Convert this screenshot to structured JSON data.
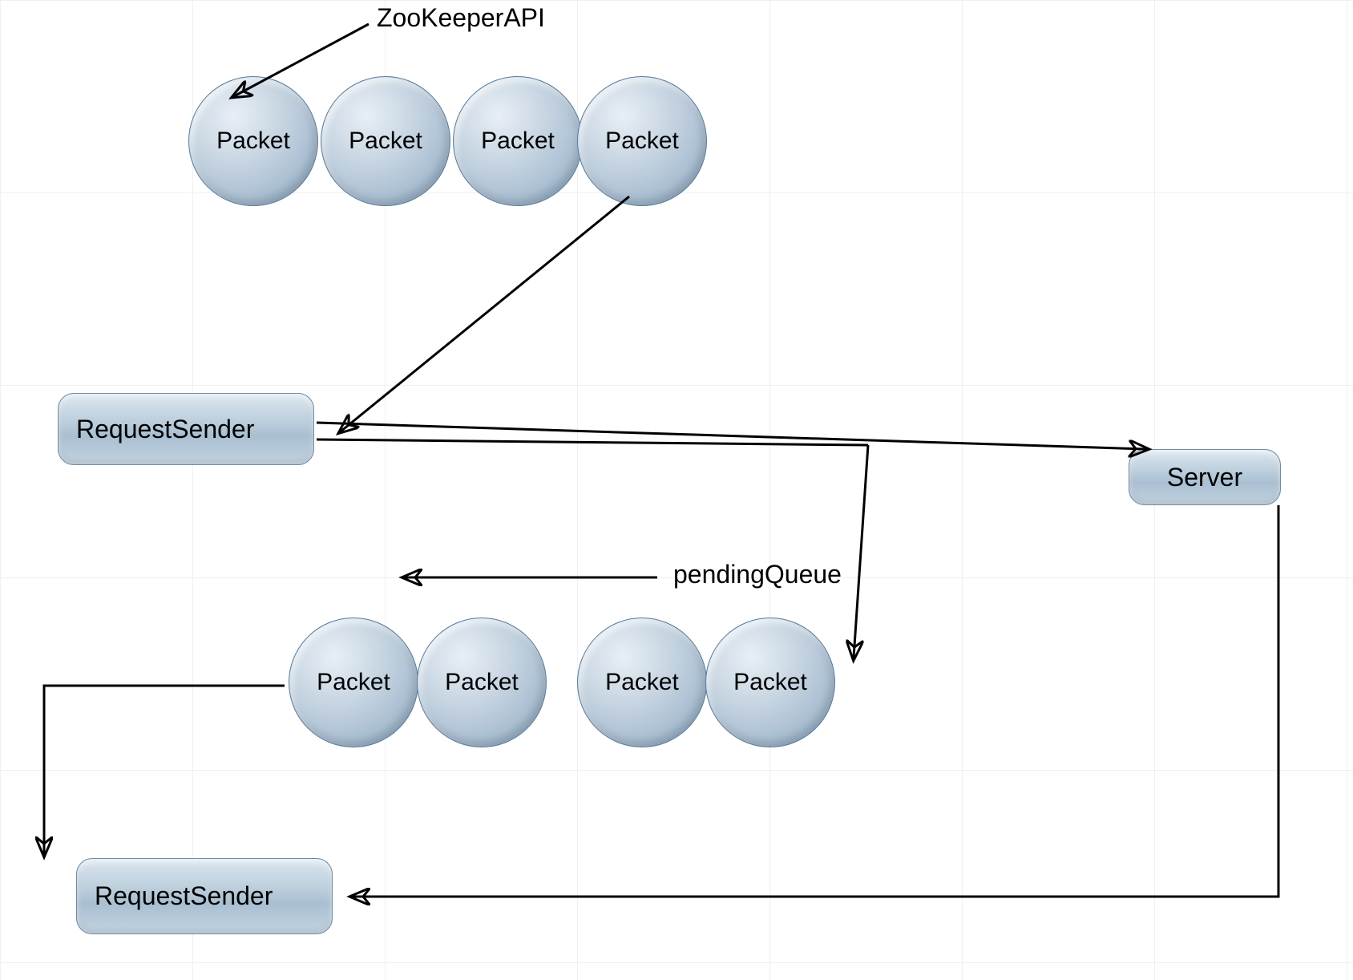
{
  "labels": {
    "zookeeper_api": "ZooKeeperAPI",
    "pending_queue": "pendingQueue"
  },
  "nodes": {
    "packet_row1": [
      "Packet",
      "Packet",
      "Packet",
      "Packet"
    ],
    "packet_row2": [
      "Packet",
      "Packet",
      "Packet",
      "Packet"
    ],
    "request_sender_top": "RequestSender",
    "request_sender_bottom": "RequestSender",
    "server": "Server"
  }
}
